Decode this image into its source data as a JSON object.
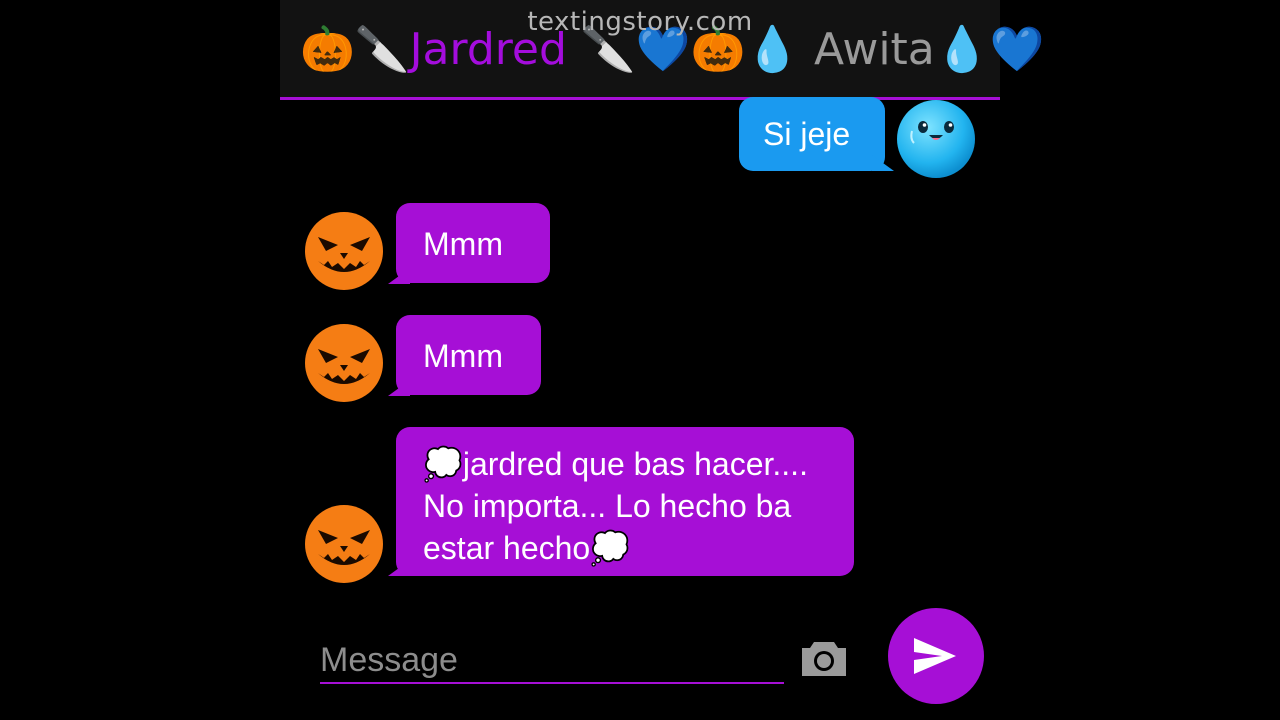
{
  "watermark": "textingstory.com",
  "header": {
    "emoji_left": "🎃🔪",
    "contact_a": "Jardred",
    "emoji_mid": "🔪💙🎃💧",
    "contact_b": "Awita",
    "emoji_right": "💧💙"
  },
  "messages": [
    {
      "sender": "Awita",
      "side": "right",
      "text": "Si jeje"
    },
    {
      "sender": "Jardred",
      "side": "left",
      "text": "Mmm"
    },
    {
      "sender": "Jardred",
      "side": "left",
      "text": "Mmm"
    },
    {
      "sender": "Jardred",
      "side": "left",
      "text": "💭jardred que bas hacer.... No importa... Lo hecho ba estar hecho💭"
    }
  ],
  "composer": {
    "placeholder": "Message"
  },
  "colors": {
    "accent": "#a60fd6",
    "sent_bubble": "#1a9af0",
    "header_bg": "#121212",
    "background": "#000000"
  },
  "icons": {
    "camera": "camera-icon",
    "send": "send-icon"
  }
}
